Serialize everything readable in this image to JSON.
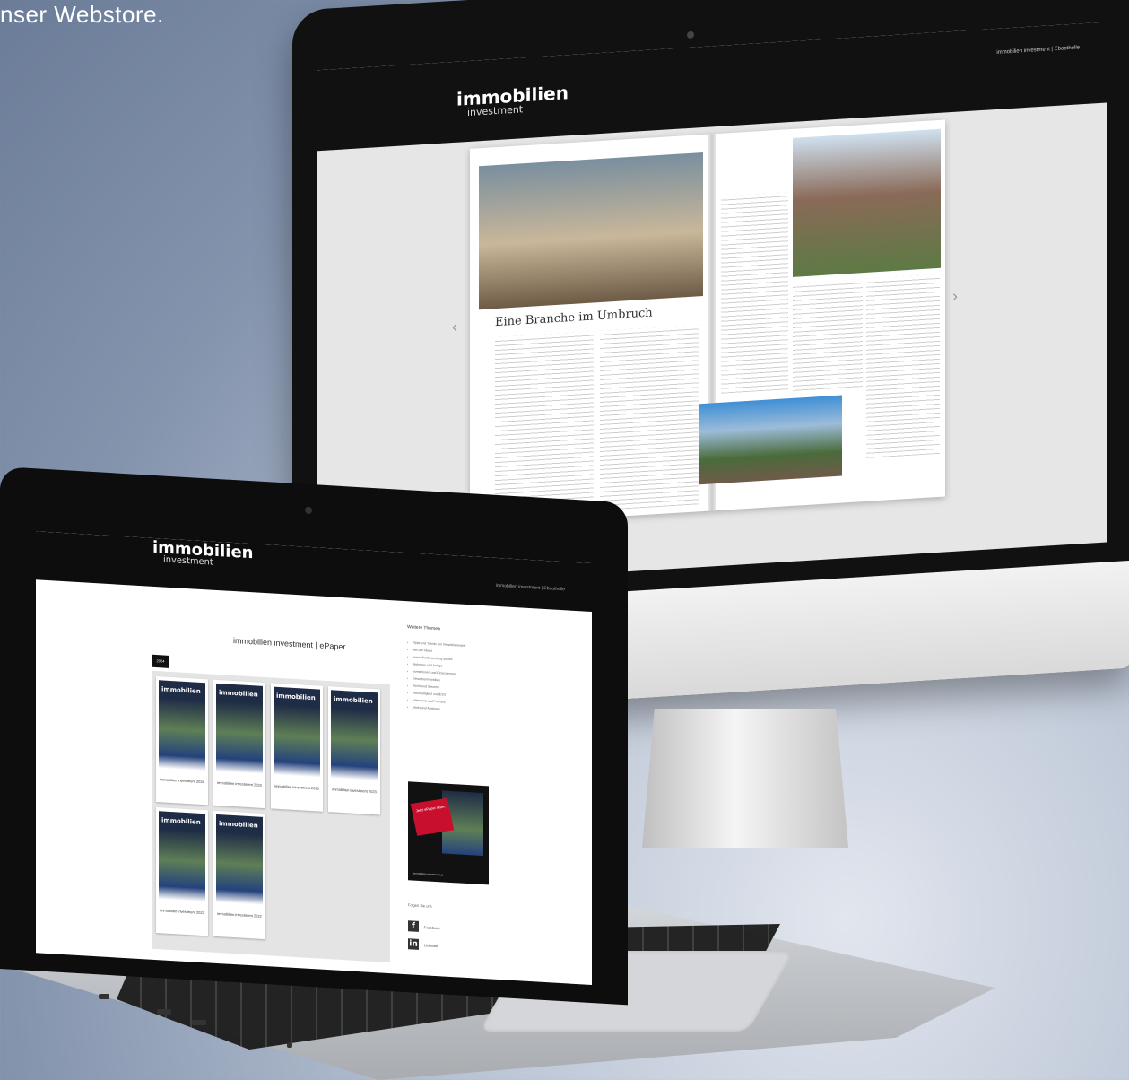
{
  "caption": "nser Webstore.",
  "monitor": {
    "logo": {
      "line1": "immobilien",
      "line2": "investment"
    },
    "nav": "immobilien investment | Eboothelle",
    "spread": {
      "headline": "Eine Branche im Umbruch",
      "prev_icon": "chevron-left-icon",
      "next_icon": "chevron-right-icon"
    }
  },
  "laptop": {
    "logo": {
      "line1": "immobilien",
      "line2": "investment"
    },
    "nav": "immobilien investment | Eboothelle",
    "store_title": "immobilien investment | ePaper",
    "filter_label": "2024",
    "covers": [
      {
        "caption": "immobilien investment 2024"
      },
      {
        "caption": "immobilien investment 2023"
      },
      {
        "caption": "immobilien investment 2023"
      },
      {
        "caption": "immobilien investment 2023"
      },
      {
        "caption": "immobilien investment 2022"
      },
      {
        "caption": "immobilien investment 2022"
      }
    ],
    "sidebar": {
      "heading": "Weitere Themen",
      "items": [
        "Tipps und Trends am Immobilienmarkt",
        "Neu am Markt",
        "Immobilienbewertung aktuell",
        "Wohnbau und Anlage",
        "Investitionen und Finanzierung",
        "Gewerbeimmobilien",
        "Recht und Steuern",
        "Nachhaltigkeit und ESG",
        "Interviews und Portraits",
        "Markt und Analysen"
      ],
      "promo_text": "Jetzt ePaper lesen",
      "promo_footer": "immobilien-investment.at",
      "follow_heading": "Folgen Sie uns",
      "social": [
        {
          "label": "Facebook",
          "icon": "facebook-icon",
          "glyph": "f"
        },
        {
          "label": "LinkedIn",
          "icon": "linkedin-icon",
          "glyph": "in"
        }
      ]
    }
  }
}
